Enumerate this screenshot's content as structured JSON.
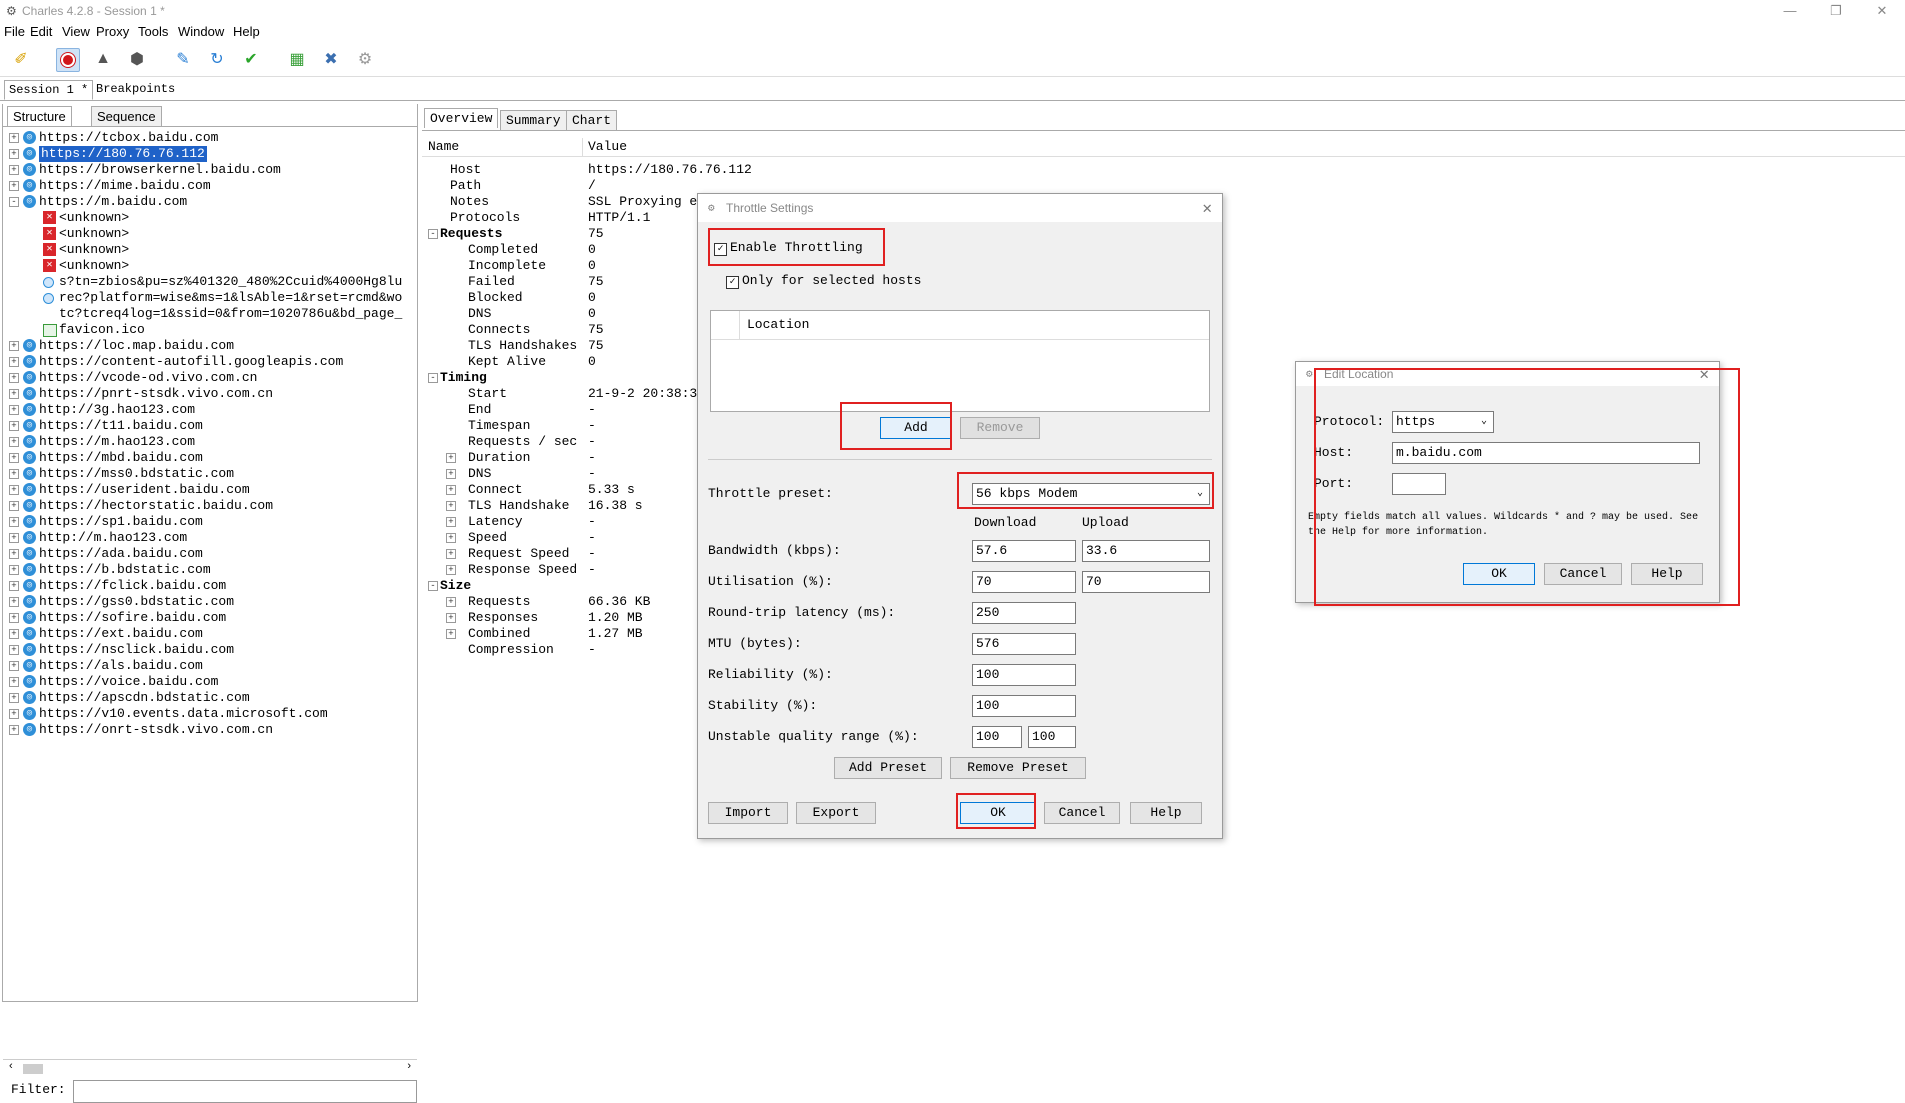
{
  "window": {
    "title": "Charles 4.2.8 - Session 1 *"
  },
  "menu": [
    "File",
    "Edit",
    "View",
    "Proxy",
    "Tools",
    "Window",
    "Help"
  ],
  "toolbar_icons": [
    "broom-icon",
    "record-icon",
    "turtle-icon",
    "hexagon-icon",
    "pen-icon",
    "refresh-icon",
    "checkmark-icon",
    "basket-icon",
    "tools-icon",
    "gear-icon"
  ],
  "session_tabs": [
    "Session 1 *",
    "Breakpoints"
  ],
  "left": {
    "tabs": [
      "Structure",
      "Sequence"
    ],
    "tree": [
      {
        "label": "https://tcbox.baidu.com",
        "icon": "globe",
        "level": 0,
        "exp": "+"
      },
      {
        "label": "https://180.76.76.112",
        "icon": "globe",
        "level": 0,
        "exp": "+",
        "selected": true
      },
      {
        "label": "https://browserkernel.baidu.com",
        "icon": "globe",
        "level": 0,
        "exp": "+"
      },
      {
        "label": "https://mime.baidu.com",
        "icon": "globe",
        "level": 0,
        "exp": "+"
      },
      {
        "label": "https://m.baidu.com",
        "icon": "globe",
        "level": 0,
        "exp": "-"
      },
      {
        "label": "<unknown>",
        "icon": "err",
        "level": 1
      },
      {
        "label": "<unknown>",
        "icon": "err",
        "level": 1
      },
      {
        "label": "<unknown>",
        "icon": "err",
        "level": 1
      },
      {
        "label": "<unknown>",
        "icon": "err",
        "level": 1
      },
      {
        "label": "s?tn=zbios&pu=sz%401320_480%2Ccuid%4000Hg8lu",
        "icon": "dot",
        "level": 1
      },
      {
        "label": "rec?platform=wise&ms=1&lsAble=1&rset=rcmd&wo",
        "icon": "dot",
        "level": 1
      },
      {
        "label": "tc?tcreq4log=1&ssid=0&from=1020786u&bd_page_",
        "icon": "none",
        "level": 1
      },
      {
        "label": "favicon.ico",
        "icon": "img",
        "level": 1
      },
      {
        "label": "https://loc.map.baidu.com",
        "icon": "globe",
        "level": 0,
        "exp": "+"
      },
      {
        "label": "https://content-autofill.googleapis.com",
        "icon": "globe",
        "level": 0,
        "exp": "+"
      },
      {
        "label": "https://vcode-od.vivo.com.cn",
        "icon": "globe",
        "level": 0,
        "exp": "+"
      },
      {
        "label": "https://pnrt-stsdk.vivo.com.cn",
        "icon": "globe",
        "level": 0,
        "exp": "+"
      },
      {
        "label": "http://3g.hao123.com",
        "icon": "globe",
        "level": 0,
        "exp": "+"
      },
      {
        "label": "https://t11.baidu.com",
        "icon": "globe",
        "level": 0,
        "exp": "+"
      },
      {
        "label": "https://m.hao123.com",
        "icon": "globe",
        "level": 0,
        "exp": "+"
      },
      {
        "label": "https://mbd.baidu.com",
        "icon": "globe",
        "level": 0,
        "exp": "+"
      },
      {
        "label": "https://mss0.bdstatic.com",
        "icon": "globe",
        "level": 0,
        "exp": "+"
      },
      {
        "label": "https://userident.baidu.com",
        "icon": "globe",
        "level": 0,
        "exp": "+"
      },
      {
        "label": "https://hectorstatic.baidu.com",
        "icon": "globe",
        "level": 0,
        "exp": "+"
      },
      {
        "label": "https://sp1.baidu.com",
        "icon": "globe",
        "level": 0,
        "exp": "+"
      },
      {
        "label": "http://m.hao123.com",
        "icon": "globe",
        "level": 0,
        "exp": "+"
      },
      {
        "label": "https://ada.baidu.com",
        "icon": "globe",
        "level": 0,
        "exp": "+"
      },
      {
        "label": "https://b.bdstatic.com",
        "icon": "globe",
        "level": 0,
        "exp": "+"
      },
      {
        "label": "https://fclick.baidu.com",
        "icon": "globe",
        "level": 0,
        "exp": "+"
      },
      {
        "label": "https://gss0.bdstatic.com",
        "icon": "globe",
        "level": 0,
        "exp": "+"
      },
      {
        "label": "https://sofire.baidu.com",
        "icon": "globe",
        "level": 0,
        "exp": "+"
      },
      {
        "label": "https://ext.baidu.com",
        "icon": "globe",
        "level": 0,
        "exp": "+"
      },
      {
        "label": "https://nsclick.baidu.com",
        "icon": "globe",
        "level": 0,
        "exp": "+"
      },
      {
        "label": "https://als.baidu.com",
        "icon": "globe",
        "level": 0,
        "exp": "+"
      },
      {
        "label": "https://voice.baidu.com",
        "icon": "globe",
        "level": 0,
        "exp": "+"
      },
      {
        "label": "https://apscdn.bdstatic.com",
        "icon": "globe",
        "level": 0,
        "exp": "+"
      },
      {
        "label": "https://v10.events.data.microsoft.com",
        "icon": "globe",
        "level": 0,
        "exp": "+"
      },
      {
        "label": "https://onrt-stsdk.vivo.com.cn",
        "icon": "globe",
        "level": 0,
        "exp": "+"
      }
    ],
    "filter_label": "Filter:"
  },
  "right": {
    "tabs": [
      "Overview",
      "Summary",
      "Chart"
    ],
    "columns": {
      "name": "Name",
      "value": "Value"
    },
    "rows": [
      {
        "name": "Host",
        "value": "https://180.76.76.112",
        "level": 1
      },
      {
        "name": "Path",
        "value": "/",
        "level": 1
      },
      {
        "name": "Notes",
        "value": "SSL Proxying e",
        "level": 1
      },
      {
        "name": "Protocols",
        "value": "HTTP/1.1",
        "level": 1
      },
      {
        "name": "Requests",
        "value": "75",
        "level": 0,
        "bold": true,
        "exp": "-"
      },
      {
        "name": "Completed",
        "value": "0",
        "level": 2
      },
      {
        "name": "Incomplete",
        "value": "0",
        "level": 2
      },
      {
        "name": "Failed",
        "value": "75",
        "level": 2
      },
      {
        "name": "Blocked",
        "value": "0",
        "level": 2
      },
      {
        "name": "DNS",
        "value": "0",
        "level": 2
      },
      {
        "name": "Connects",
        "value": "75",
        "level": 2
      },
      {
        "name": "TLS Handshakes",
        "value": "75",
        "level": 2
      },
      {
        "name": "Kept Alive",
        "value": "0",
        "level": 2
      },
      {
        "name": "Timing",
        "value": "",
        "level": 0,
        "bold": true,
        "exp": "-"
      },
      {
        "name": "Start",
        "value": "21-9-2 20:38:3",
        "level": 2
      },
      {
        "name": "End",
        "value": "-",
        "level": 2
      },
      {
        "name": "Timespan",
        "value": "-",
        "level": 2
      },
      {
        "name": "Requests / sec",
        "value": "-",
        "level": 2
      },
      {
        "name": "Duration",
        "value": "-",
        "level": 2,
        "exp": "+"
      },
      {
        "name": "DNS",
        "value": "-",
        "level": 2,
        "exp": "+"
      },
      {
        "name": "Connect",
        "value": "5.33 s",
        "level": 2,
        "exp": "+"
      },
      {
        "name": "TLS Handshake",
        "value": "16.38 s",
        "level": 2,
        "exp": "+"
      },
      {
        "name": "Latency",
        "value": "-",
        "level": 2,
        "exp": "+"
      },
      {
        "name": "Speed",
        "value": "-",
        "level": 2,
        "exp": "+"
      },
      {
        "name": "Request Speed",
        "value": "-",
        "level": 2,
        "exp": "+"
      },
      {
        "name": "Response Speed",
        "value": "-",
        "level": 2,
        "exp": "+"
      },
      {
        "name": "Size",
        "value": "",
        "level": 0,
        "bold": true,
        "exp": "-"
      },
      {
        "name": "Requests",
        "value": "66.36 KB",
        "level": 2,
        "exp": "+"
      },
      {
        "name": "Responses",
        "value": "1.20 MB",
        "level": 2,
        "exp": "+"
      },
      {
        "name": "Combined",
        "value": "1.27 MB",
        "level": 2,
        "exp": "+"
      },
      {
        "name": "Compression",
        "value": "-",
        "level": 2
      }
    ]
  },
  "throttle": {
    "title": "Throttle Settings",
    "enable": "Enable Throttling",
    "only_selected": "Only for selected hosts",
    "location_header": "Location",
    "add": "Add",
    "remove": "Remove",
    "preset_label": "Throttle preset:",
    "preset_value": "56 kbps Modem",
    "download": "Download",
    "upload": "Upload",
    "bandwidth_label": "Bandwidth (kbps):",
    "bandwidth_down": "57.6",
    "bandwidth_up": "33.6",
    "utilisation_label": "Utilisation (%):",
    "util_down": "70",
    "util_up": "70",
    "latency_label": "Round-trip latency (ms):",
    "latency": "250",
    "mtu_label": "MTU (bytes):",
    "mtu": "576",
    "reliability_label": "Reliability (%):",
    "reliability": "100",
    "stability_label": "Stability (%):",
    "stability": "100",
    "unstable_label": "Unstable quality range (%):",
    "unstable_1": "100",
    "unstable_2": "100",
    "add_preset": "Add Preset",
    "remove_preset": "Remove Preset",
    "import": "Import",
    "export": "Export",
    "ok": "OK",
    "cancel": "Cancel",
    "help": "Help"
  },
  "edit_location": {
    "title": "Edit Location",
    "protocol_label": "Protocol:",
    "protocol_value": "https",
    "host_label": "Host:",
    "host_value": "m.baidu.com",
    "port_label": "Port:",
    "port_value": "",
    "hint_1": "Empty fields match all values. Wildcards * and ? may be used. See",
    "hint_2": "the Help for more information.",
    "ok": "OK",
    "cancel": "Cancel",
    "help": "Help"
  },
  "colors": {
    "highlight": "#e02020",
    "selection": "#1f62c8",
    "globe": "#2f8fd8"
  }
}
